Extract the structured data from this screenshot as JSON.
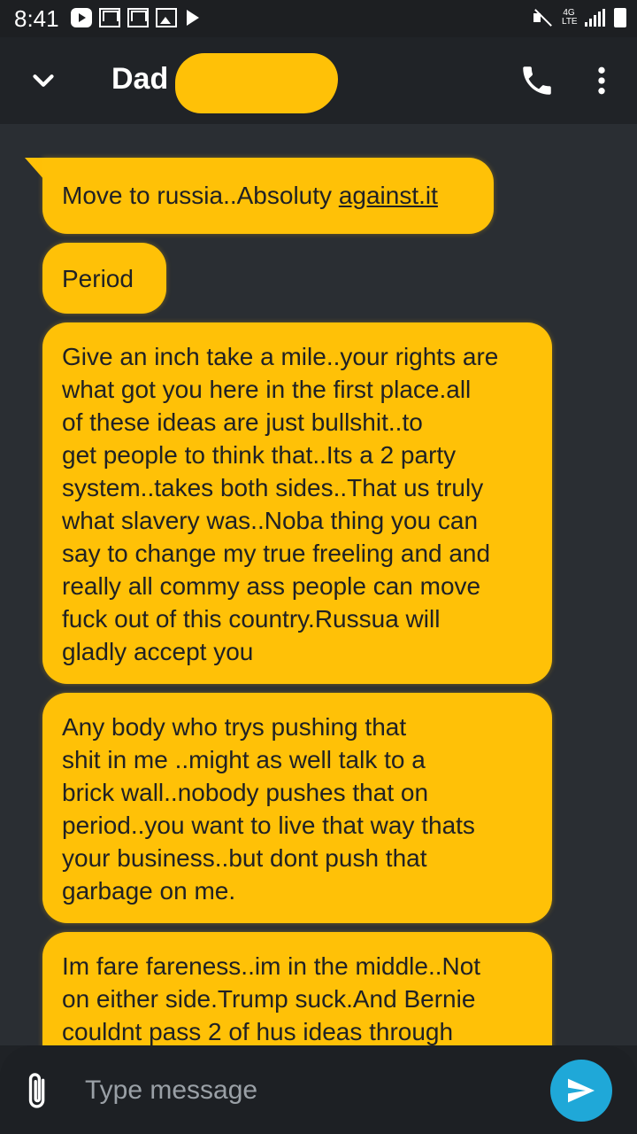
{
  "status_bar": {
    "time": "8:41",
    "network": "4G LTE"
  },
  "header": {
    "contact_name": "Dad (",
    "redaction_color": "#ffc107"
  },
  "messages": [
    {
      "text_prefix": "Move to russia..Absoluty ",
      "link_text": "against.it"
    },
    {
      "text": "Period"
    },
    {
      "text": "Give an inch take a mile..your rights are\nwhat got you here in the first place.all\nof these ideas are just bullshit..to\nget people to think that..Its a 2 party\nsystem..takes both sides..That us truly\nwhat slavery was..Noba thing you can\nsay to change my true freeling and and\nreally all commy ass people can move\nfuck out of this country.Russua will\ngladly accept you"
    },
    {
      "text": "Any body who trys pushing that\nshit in me ..might as well talk to a\nbrick wall..nobody pushes that on\nperiod..you want to live that way thats\nyour business..but dont push that\ngarbage on me."
    },
    {
      "text": "Im fare fareness..im in the middle..Not\non either side.Trump suck.And Bernie\ncouldnt pass 2 of hus ideas through"
    }
  ],
  "composer": {
    "placeholder": "Type message"
  },
  "colors": {
    "bubble": "#ffc107",
    "background": "#2a2e33",
    "send_button": "#1fa8d8"
  }
}
